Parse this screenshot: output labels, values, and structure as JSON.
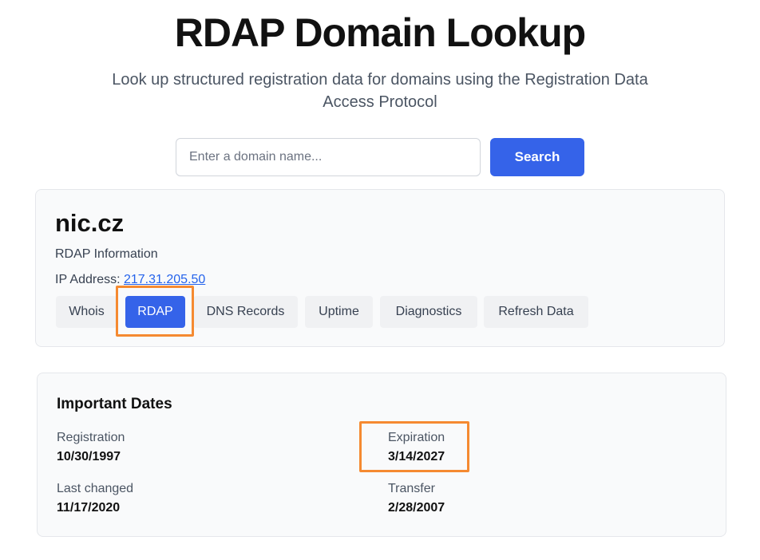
{
  "header": {
    "title": "RDAP Domain Lookup",
    "subtitle": "Look up structured registration data for domains using the Registration Data Access Protocol"
  },
  "search": {
    "placeholder": "Enter a domain name...",
    "value": "",
    "button_label": "Search"
  },
  "domain_card": {
    "name": "nic.cz",
    "subtitle": "RDAP Information",
    "ip_label": "IP Address:",
    "ip_value": "217.31.205.50",
    "tabs": [
      {
        "label": "Whois",
        "active": false
      },
      {
        "label": "RDAP",
        "active": true
      },
      {
        "label": "DNS Records",
        "active": false
      },
      {
        "label": "Uptime",
        "active": false
      },
      {
        "label": "Diagnostics",
        "active": false
      },
      {
        "label": "Refresh Data",
        "active": false
      }
    ]
  },
  "dates_card": {
    "title": "Important Dates",
    "registration": {
      "label": "Registration",
      "value": "10/30/1997"
    },
    "expiration": {
      "label": "Expiration",
      "value": "3/14/2027"
    },
    "last_changed": {
      "label": "Last changed",
      "value": "11/17/2020"
    },
    "transfer": {
      "label": "Transfer",
      "value": "2/28/2007"
    }
  },
  "colors": {
    "accent": "#3563e9",
    "highlight": "#f58a31",
    "link": "#2563eb"
  }
}
